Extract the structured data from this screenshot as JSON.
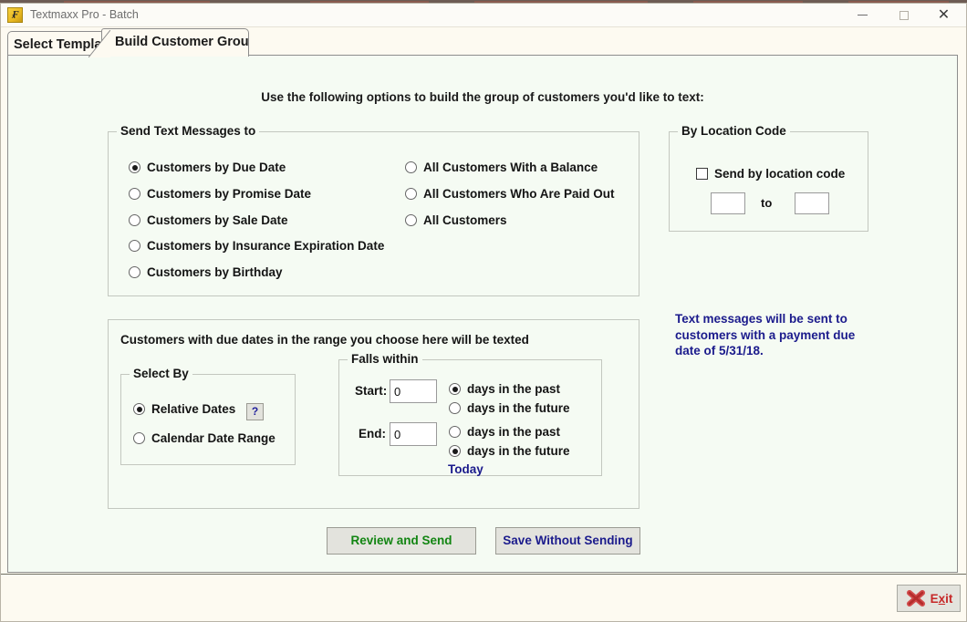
{
  "window": {
    "title": "Textmaxx Pro - Batch",
    "app_icon": "textmaxx-app-icon",
    "minimize_label": "—",
    "maximize_label": "□",
    "close_label": "✕"
  },
  "tabs": [
    {
      "label": "Select Template",
      "active": false
    },
    {
      "label": "Build Customer Group",
      "active": true
    }
  ],
  "instruction": "Use the following options to build the group of customers you'd like to text:",
  "send_group": {
    "legend": "Send Text Messages to",
    "left_options": [
      {
        "label": "Customers by Due Date",
        "selected": true
      },
      {
        "label": "Customers by Promise Date",
        "selected": false
      },
      {
        "label": "Customers by Sale Date",
        "selected": false
      },
      {
        "label": "Customers by Insurance Expiration Date",
        "selected": false
      },
      {
        "label": "Customers by Birthday",
        "selected": false
      }
    ],
    "right_options": [
      {
        "label": "All Customers With a Balance",
        "selected": false
      },
      {
        "label": "All Customers Who Are Paid Out",
        "selected": false
      },
      {
        "label": "All Customers",
        "selected": false
      }
    ]
  },
  "location_group": {
    "legend": "By Location Code",
    "checkbox_label": "Send by location code",
    "checkbox_checked": false,
    "from_value": "",
    "to_label": "to",
    "to_value": ""
  },
  "info_message": "Text messages will be sent to customers with a payment due date of 5/31/18.",
  "dates_group": {
    "caption": "Customers with due dates in the range you choose here will be texted",
    "select_by": {
      "legend": "Select By",
      "options": [
        {
          "label": "Relative Dates",
          "selected": true
        },
        {
          "label": "Calendar Date Range",
          "selected": false
        }
      ],
      "help_label": "?"
    },
    "falls_within": {
      "legend": "Falls within",
      "start_label": "Start:",
      "start_value": "0",
      "start_options": [
        {
          "label": "days in the past",
          "selected": true
        },
        {
          "label": "days in the future",
          "selected": false
        }
      ],
      "end_label": "End:",
      "end_value": "0",
      "end_options": [
        {
          "label": "days in the past",
          "selected": false
        },
        {
          "label": "days in the future",
          "selected": true
        }
      ],
      "today_link": "Today"
    }
  },
  "actions": {
    "review_label": "Review and Send",
    "save_label": "Save Without Sending",
    "exit_label_pre": "E",
    "exit_label_accel": "x",
    "exit_label_post": "it"
  },
  "colors": {
    "accent_green": "#128512",
    "accent_navy": "#1b1b8c",
    "accent_red": "#c62828",
    "pane_bg": "#f5fbf3",
    "window_bg": "#fdfaf1"
  }
}
